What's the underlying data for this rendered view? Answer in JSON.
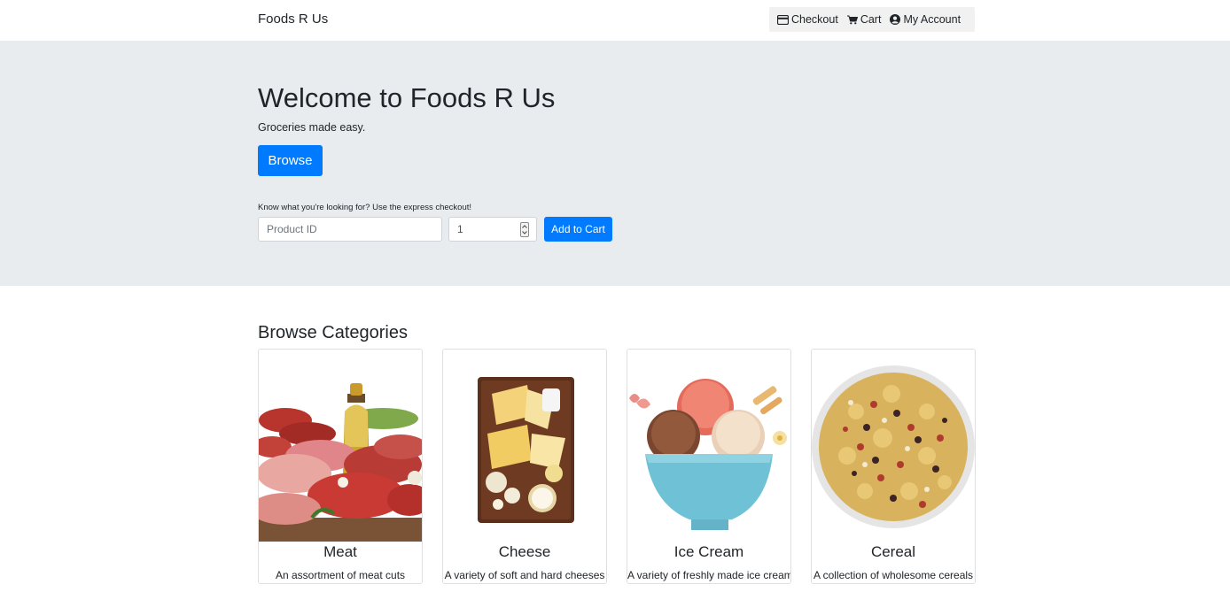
{
  "navbar": {
    "brand": "Foods R Us",
    "links": [
      {
        "label": "Checkout",
        "icon": "credit-card-icon"
      },
      {
        "label": "Cart",
        "icon": "shopping-cart-icon"
      },
      {
        "label": "My Account",
        "icon": "user-circle-icon"
      }
    ]
  },
  "hero": {
    "title": "Welcome to Foods R Us",
    "subtitle": "Groceries made easy.",
    "browse_label": "Browse",
    "express_label": "Know what you're looking for? Use the express checkout!",
    "product_id_placeholder": "Product ID",
    "quantity_value": "1",
    "add_to_cart_label": "Add to Cart"
  },
  "categories": {
    "title": "Browse Categories",
    "items": [
      {
        "name": "Meat",
        "description": "An assortment of meat cuts"
      },
      {
        "name": "Cheese",
        "description": "A variety of soft and hard cheeses"
      },
      {
        "name": "Ice Cream",
        "description": "A variety of freshly made ice cream"
      },
      {
        "name": "Cereal",
        "description": "A collection of wholesome cereals"
      }
    ]
  },
  "colors": {
    "primary": "#007bff",
    "hero_bg": "#e9ecef",
    "text": "#212529"
  }
}
